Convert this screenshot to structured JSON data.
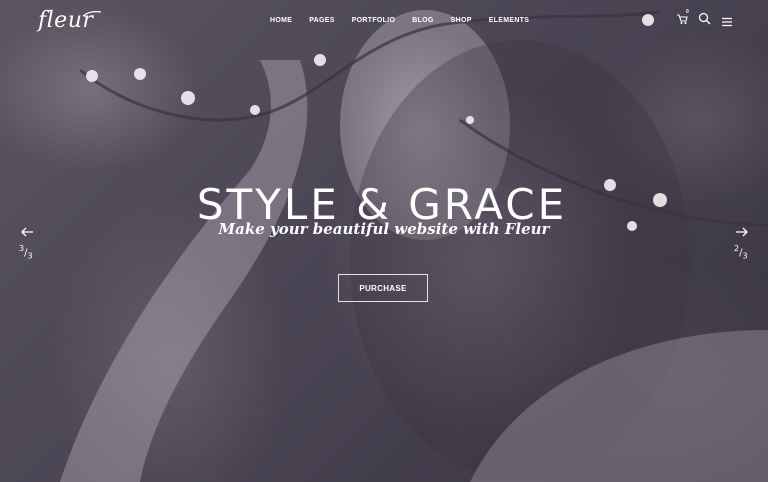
{
  "brand": {
    "logo": "fleur"
  },
  "nav": {
    "items": [
      "HOME",
      "PAGES",
      "PORTFOLIO",
      "BLOG",
      "SHOP",
      "ELEMENTS"
    ],
    "cart_count": "0",
    "icons": [
      "cart-icon",
      "search-icon",
      "menu-icon"
    ]
  },
  "slide": {
    "headline": "STYLE & GRACE",
    "subtitle": "Make your beautiful website with Fleur",
    "button": "PURCHASE"
  },
  "slider": {
    "prev": {
      "current": "3",
      "total": "3"
    },
    "next": {
      "current": "2",
      "total": "3"
    }
  },
  "colors": {
    "text": "#ffffff",
    "overlay": "#3f3a47"
  }
}
